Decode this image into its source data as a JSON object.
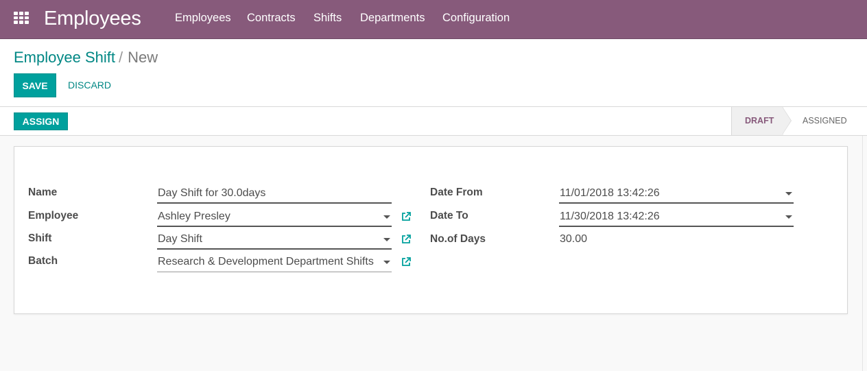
{
  "navbar": {
    "app_title": "Employees",
    "menu": [
      "Employees",
      "Contracts",
      "Shifts",
      "Departments",
      "Configuration"
    ]
  },
  "breadcrumb": {
    "parent": "Employee Shift",
    "separator": "/",
    "current": "New"
  },
  "buttons": {
    "save": "SAVE",
    "discard": "DISCARD",
    "assign": "ASSIGN"
  },
  "statusbar": {
    "stages": [
      "DRAFT",
      "ASSIGNED"
    ],
    "active_stage": "DRAFT"
  },
  "form": {
    "name": {
      "label": "Name",
      "value": "Day Shift for 30.0days"
    },
    "employee": {
      "label": "Employee",
      "value": "Ashley Presley"
    },
    "shift": {
      "label": "Shift",
      "value": "Day Shift"
    },
    "batch": {
      "label": "Batch",
      "value": "Research & Development Department Shifts"
    },
    "date_from": {
      "label": "Date From",
      "value": "11/01/2018 13:42:26"
    },
    "date_to": {
      "label": "Date To",
      "value": "11/30/2018 13:42:26"
    },
    "no_of_days": {
      "label": "No.of Days",
      "value": "30.00"
    }
  },
  "colors": {
    "navbar": "#875a7b",
    "primary": "#00a09d",
    "link": "#008784",
    "active_stage": "#875a7b"
  },
  "icons": {
    "apps": "apps-grid-icon",
    "external_link": "external-link-icon",
    "dropdown": "caret-down-icon"
  }
}
